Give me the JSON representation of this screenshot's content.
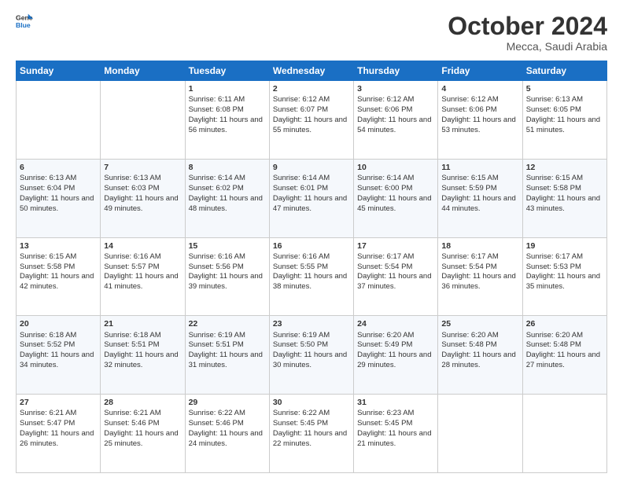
{
  "header": {
    "logo": {
      "general": "General",
      "blue": "Blue"
    },
    "title": "October 2024",
    "subtitle": "Mecca, Saudi Arabia"
  },
  "weekdays": [
    "Sunday",
    "Monday",
    "Tuesday",
    "Wednesday",
    "Thursday",
    "Friday",
    "Saturday"
  ],
  "weeks": [
    [
      {
        "day": "",
        "sunrise": "",
        "sunset": "",
        "daylight": ""
      },
      {
        "day": "",
        "sunrise": "",
        "sunset": "",
        "daylight": ""
      },
      {
        "day": "1",
        "sunrise": "Sunrise: 6:11 AM",
        "sunset": "Sunset: 6:08 PM",
        "daylight": "Daylight: 11 hours and 56 minutes."
      },
      {
        "day": "2",
        "sunrise": "Sunrise: 6:12 AM",
        "sunset": "Sunset: 6:07 PM",
        "daylight": "Daylight: 11 hours and 55 minutes."
      },
      {
        "day": "3",
        "sunrise": "Sunrise: 6:12 AM",
        "sunset": "Sunset: 6:06 PM",
        "daylight": "Daylight: 11 hours and 54 minutes."
      },
      {
        "day": "4",
        "sunrise": "Sunrise: 6:12 AM",
        "sunset": "Sunset: 6:06 PM",
        "daylight": "Daylight: 11 hours and 53 minutes."
      },
      {
        "day": "5",
        "sunrise": "Sunrise: 6:13 AM",
        "sunset": "Sunset: 6:05 PM",
        "daylight": "Daylight: 11 hours and 51 minutes."
      }
    ],
    [
      {
        "day": "6",
        "sunrise": "Sunrise: 6:13 AM",
        "sunset": "Sunset: 6:04 PM",
        "daylight": "Daylight: 11 hours and 50 minutes."
      },
      {
        "day": "7",
        "sunrise": "Sunrise: 6:13 AM",
        "sunset": "Sunset: 6:03 PM",
        "daylight": "Daylight: 11 hours and 49 minutes."
      },
      {
        "day": "8",
        "sunrise": "Sunrise: 6:14 AM",
        "sunset": "Sunset: 6:02 PM",
        "daylight": "Daylight: 11 hours and 48 minutes."
      },
      {
        "day": "9",
        "sunrise": "Sunrise: 6:14 AM",
        "sunset": "Sunset: 6:01 PM",
        "daylight": "Daylight: 11 hours and 47 minutes."
      },
      {
        "day": "10",
        "sunrise": "Sunrise: 6:14 AM",
        "sunset": "Sunset: 6:00 PM",
        "daylight": "Daylight: 11 hours and 45 minutes."
      },
      {
        "day": "11",
        "sunrise": "Sunrise: 6:15 AM",
        "sunset": "Sunset: 5:59 PM",
        "daylight": "Daylight: 11 hours and 44 minutes."
      },
      {
        "day": "12",
        "sunrise": "Sunrise: 6:15 AM",
        "sunset": "Sunset: 5:58 PM",
        "daylight": "Daylight: 11 hours and 43 minutes."
      }
    ],
    [
      {
        "day": "13",
        "sunrise": "Sunrise: 6:15 AM",
        "sunset": "Sunset: 5:58 PM",
        "daylight": "Daylight: 11 hours and 42 minutes."
      },
      {
        "day": "14",
        "sunrise": "Sunrise: 6:16 AM",
        "sunset": "Sunset: 5:57 PM",
        "daylight": "Daylight: 11 hours and 41 minutes."
      },
      {
        "day": "15",
        "sunrise": "Sunrise: 6:16 AM",
        "sunset": "Sunset: 5:56 PM",
        "daylight": "Daylight: 11 hours and 39 minutes."
      },
      {
        "day": "16",
        "sunrise": "Sunrise: 6:16 AM",
        "sunset": "Sunset: 5:55 PM",
        "daylight": "Daylight: 11 hours and 38 minutes."
      },
      {
        "day": "17",
        "sunrise": "Sunrise: 6:17 AM",
        "sunset": "Sunset: 5:54 PM",
        "daylight": "Daylight: 11 hours and 37 minutes."
      },
      {
        "day": "18",
        "sunrise": "Sunrise: 6:17 AM",
        "sunset": "Sunset: 5:54 PM",
        "daylight": "Daylight: 11 hours and 36 minutes."
      },
      {
        "day": "19",
        "sunrise": "Sunrise: 6:17 AM",
        "sunset": "Sunset: 5:53 PM",
        "daylight": "Daylight: 11 hours and 35 minutes."
      }
    ],
    [
      {
        "day": "20",
        "sunrise": "Sunrise: 6:18 AM",
        "sunset": "Sunset: 5:52 PM",
        "daylight": "Daylight: 11 hours and 34 minutes."
      },
      {
        "day": "21",
        "sunrise": "Sunrise: 6:18 AM",
        "sunset": "Sunset: 5:51 PM",
        "daylight": "Daylight: 11 hours and 32 minutes."
      },
      {
        "day": "22",
        "sunrise": "Sunrise: 6:19 AM",
        "sunset": "Sunset: 5:51 PM",
        "daylight": "Daylight: 11 hours and 31 minutes."
      },
      {
        "day": "23",
        "sunrise": "Sunrise: 6:19 AM",
        "sunset": "Sunset: 5:50 PM",
        "daylight": "Daylight: 11 hours and 30 minutes."
      },
      {
        "day": "24",
        "sunrise": "Sunrise: 6:20 AM",
        "sunset": "Sunset: 5:49 PM",
        "daylight": "Daylight: 11 hours and 29 minutes."
      },
      {
        "day": "25",
        "sunrise": "Sunrise: 6:20 AM",
        "sunset": "Sunset: 5:48 PM",
        "daylight": "Daylight: 11 hours and 28 minutes."
      },
      {
        "day": "26",
        "sunrise": "Sunrise: 6:20 AM",
        "sunset": "Sunset: 5:48 PM",
        "daylight": "Daylight: 11 hours and 27 minutes."
      }
    ],
    [
      {
        "day": "27",
        "sunrise": "Sunrise: 6:21 AM",
        "sunset": "Sunset: 5:47 PM",
        "daylight": "Daylight: 11 hours and 26 minutes."
      },
      {
        "day": "28",
        "sunrise": "Sunrise: 6:21 AM",
        "sunset": "Sunset: 5:46 PM",
        "daylight": "Daylight: 11 hours and 25 minutes."
      },
      {
        "day": "29",
        "sunrise": "Sunrise: 6:22 AM",
        "sunset": "Sunset: 5:46 PM",
        "daylight": "Daylight: 11 hours and 24 minutes."
      },
      {
        "day": "30",
        "sunrise": "Sunrise: 6:22 AM",
        "sunset": "Sunset: 5:45 PM",
        "daylight": "Daylight: 11 hours and 22 minutes."
      },
      {
        "day": "31",
        "sunrise": "Sunrise: 6:23 AM",
        "sunset": "Sunset: 5:45 PM",
        "daylight": "Daylight: 11 hours and 21 minutes."
      },
      {
        "day": "",
        "sunrise": "",
        "sunset": "",
        "daylight": ""
      },
      {
        "day": "",
        "sunrise": "",
        "sunset": "",
        "daylight": ""
      }
    ]
  ]
}
